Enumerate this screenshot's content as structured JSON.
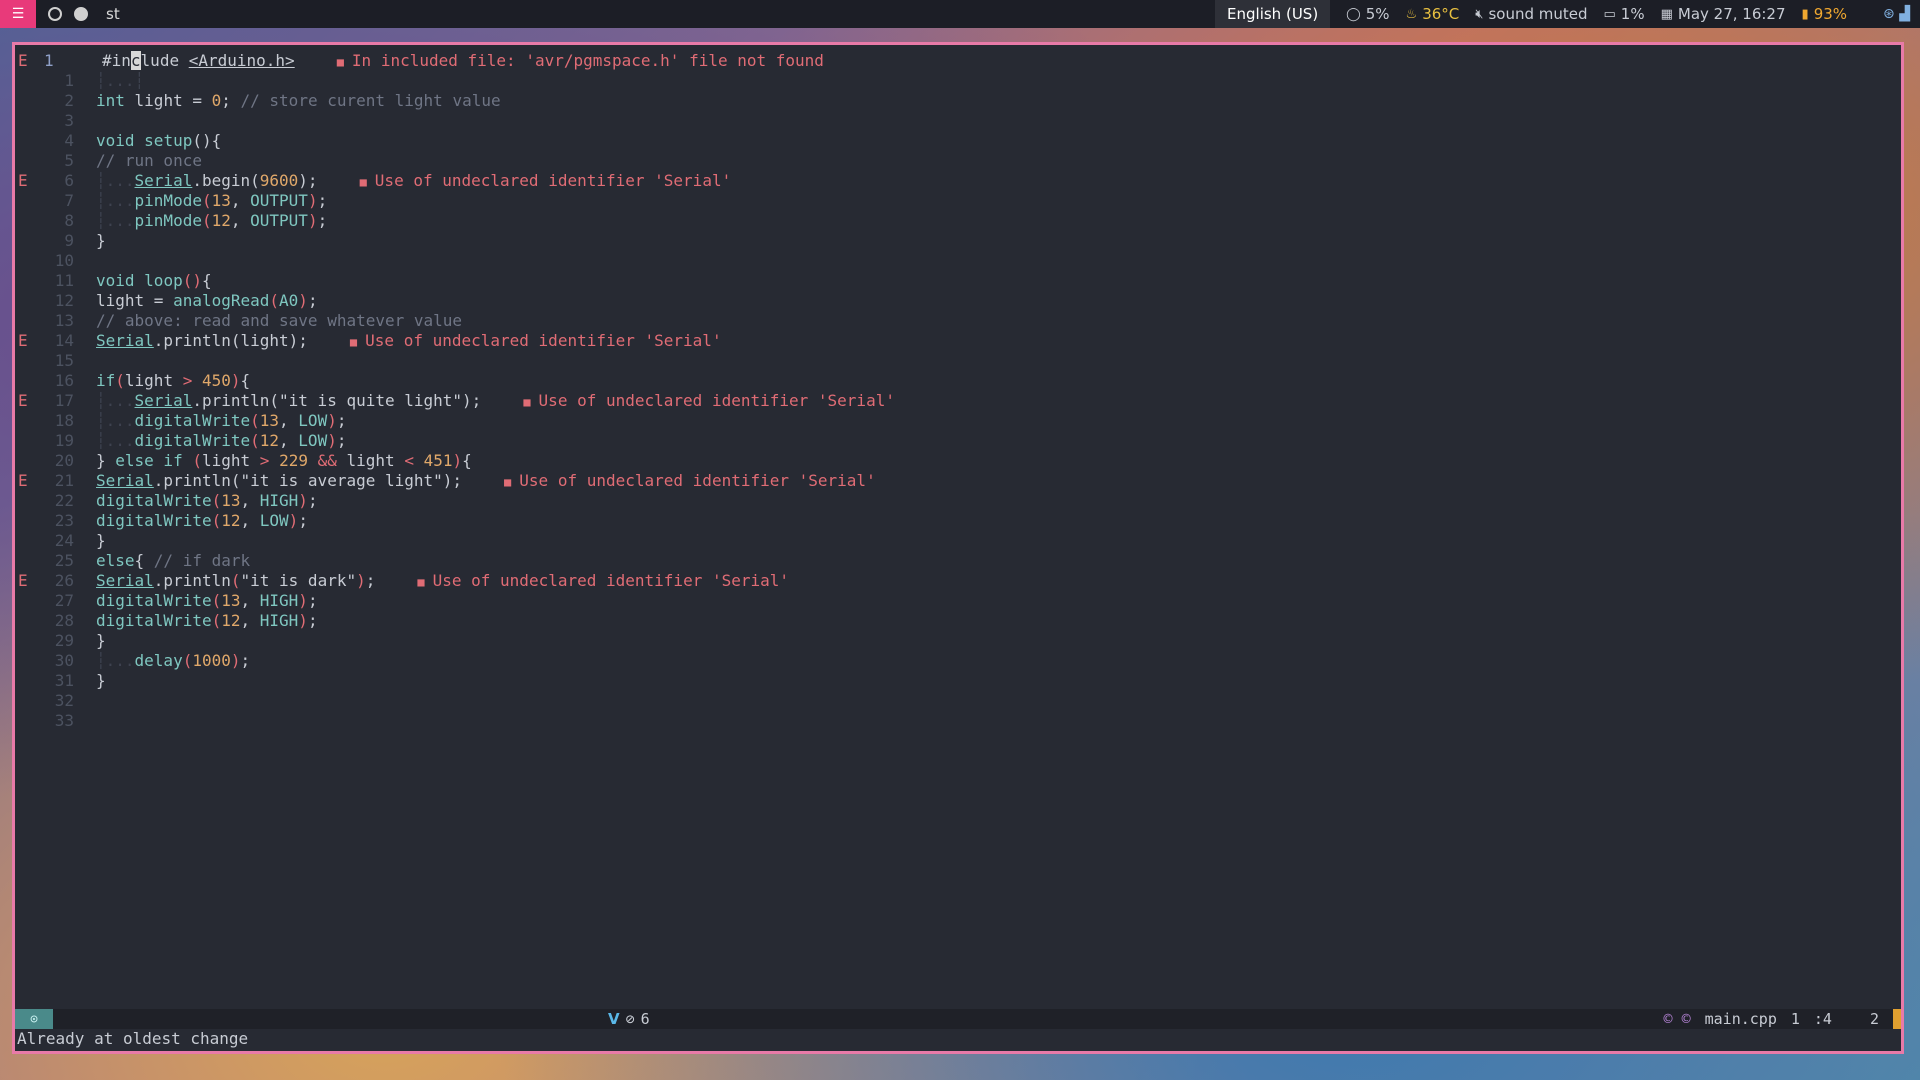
{
  "topbar": {
    "menu_icon": "menu-icon",
    "title": "st",
    "language": "English (US)",
    "cpu": "5%",
    "temperature": "36°C",
    "sound": "sound muted",
    "disk": "1%",
    "datetime": "May 27, 16:27",
    "battery": "93%"
  },
  "editor": {
    "lines": [
      {
        "n": "1",
        "sign": "E"
      },
      {
        "n": "1"
      },
      {
        "n": "2"
      },
      {
        "n": "3"
      },
      {
        "n": "4"
      },
      {
        "n": "5"
      },
      {
        "n": "6",
        "sign": "E"
      },
      {
        "n": "7"
      },
      {
        "n": "8"
      },
      {
        "n": "9"
      },
      {
        "n": "10"
      },
      {
        "n": "11"
      },
      {
        "n": "12"
      },
      {
        "n": "13"
      },
      {
        "n": "14",
        "sign": "E"
      },
      {
        "n": "15"
      },
      {
        "n": "16"
      },
      {
        "n": "17",
        "sign": "E"
      },
      {
        "n": "18"
      },
      {
        "n": "19"
      },
      {
        "n": "20"
      },
      {
        "n": "21",
        "sign": "E"
      },
      {
        "n": "22"
      },
      {
        "n": "23"
      },
      {
        "n": "24"
      },
      {
        "n": "25"
      },
      {
        "n": "26",
        "sign": "E"
      },
      {
        "n": "27"
      },
      {
        "n": "28"
      },
      {
        "n": "29"
      },
      {
        "n": "30"
      },
      {
        "n": "31"
      },
      {
        "n": "32"
      },
      {
        "n": "33"
      }
    ],
    "diagnostics": {
      "d0": "In included file: 'avr/pgmspace.h' file not found",
      "d6": "Use of undeclared identifier 'Serial'",
      "d14": "Use of undeclared identifier 'Serial'",
      "d17": "Use of undeclared identifier 'Serial'",
      "d21": "Use of undeclared identifier 'Serial'",
      "d26": "Use of undeclared identifier 'Serial'"
    }
  },
  "statusline": {
    "mode_icon": "target-icon",
    "plugin_letter": "V",
    "diag_count": "6",
    "filename": "main.cpp",
    "line": "1",
    "col": ":4",
    "extra": "2"
  },
  "cmdline": "Already at oldest change",
  "colors": {
    "accent": "#e87aa8",
    "error": "#e06c75",
    "keyword": "#7fc7c0",
    "number": "#e0a86a",
    "background": "#272a33"
  }
}
